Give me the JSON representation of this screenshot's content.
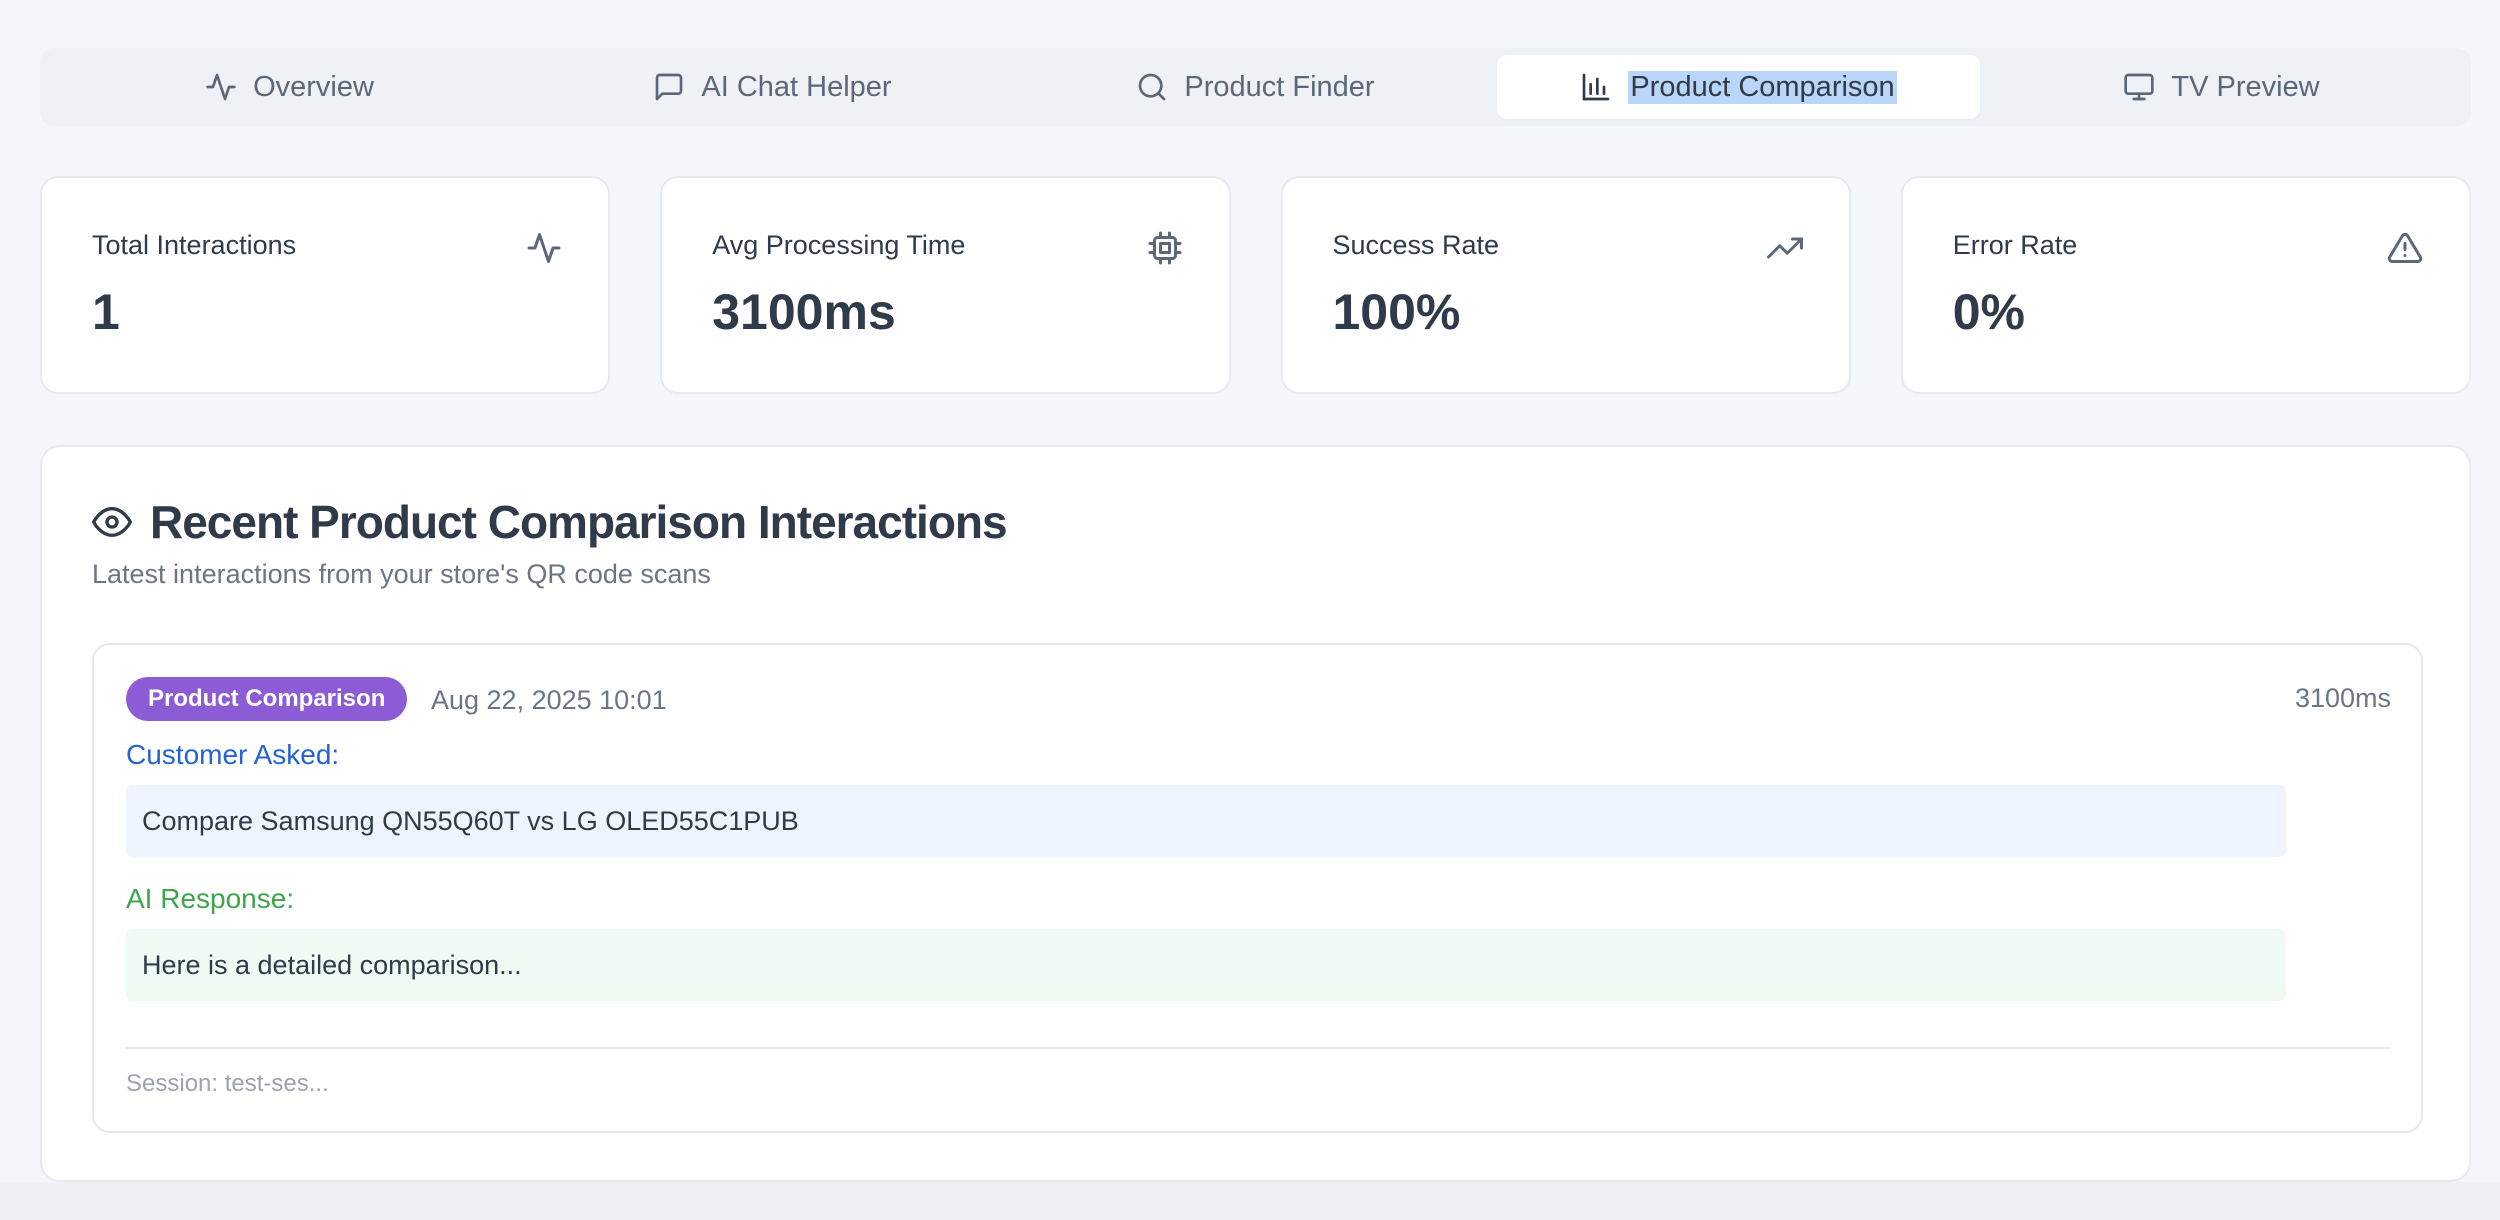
{
  "tabs": [
    {
      "label": "Overview",
      "icon": "activity-icon",
      "active": false
    },
    {
      "label": "AI Chat Helper",
      "icon": "message-square-icon",
      "active": false
    },
    {
      "label": "Product Finder",
      "icon": "search-icon",
      "active": false
    },
    {
      "label": "Product Comparison",
      "icon": "bar-chart-icon",
      "active": true
    },
    {
      "label": "TV Preview",
      "icon": "monitor-icon",
      "active": false
    }
  ],
  "stats": [
    {
      "title": "Total Interactions",
      "value": "1",
      "icon": "activity-icon"
    },
    {
      "title": "Avg Processing Time",
      "value": "3100ms",
      "icon": "cpu-icon"
    },
    {
      "title": "Success Rate",
      "value": "100%",
      "icon": "trending-up-icon"
    },
    {
      "title": "Error Rate",
      "value": "0%",
      "icon": "alert-triangle-icon"
    }
  ],
  "panel": {
    "title": "Recent Product Comparison Interactions",
    "subtitle": "Latest interactions from your store's QR code scans",
    "icon": "eye-icon"
  },
  "interaction": {
    "badge": "Product Comparison",
    "date": "Aug 22, 2025 10:01",
    "duration": "3100ms",
    "asked_label": "Customer Asked:",
    "asked_text": "Compare Samsung QN55Q60T vs LG OLED55C1PUB",
    "response_label": "AI Response:",
    "response_text": "Here is a detailed comparison...",
    "session": "Session: test-ses..."
  },
  "colors": {
    "badge": "#8b5cd6",
    "asked_label": "#2563d4",
    "response_label": "#3da54b",
    "selection_highlight": "#b9d5f7"
  }
}
